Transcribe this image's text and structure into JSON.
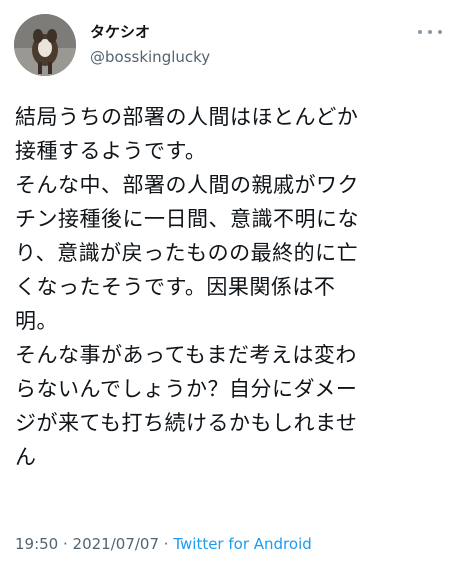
{
  "author": {
    "display_name": "タケシオ",
    "handle": "@bosskinglucky",
    "avatar_icon": "dog-photo-avatar"
  },
  "more_icon": "more-horizontal-icon",
  "tweet": {
    "lines": [
      "結局うちの部署の人間はほとんどか",
      "接種するようです。",
      "そんな中、部署の人間の親戚がワク",
      "チン接種後に一日間、意識不明にな",
      "り、意識が戻ったものの最終的に亡",
      "くなったそうです。因果関係は不",
      "明。",
      "そんな事があってもまだ考えは変わ",
      "らないんでしょうか？自分にダメー",
      "ジが来ても打ち続けるかもしれませ",
      "ん"
    ]
  },
  "meta": {
    "time": "19:50",
    "separator1": " · ",
    "date": "2021/07/07",
    "separator2": " · ",
    "source": "Twitter for Android"
  },
  "colors": {
    "text": "#0f1419",
    "secondary": "#536471",
    "link": "#1d9bf0"
  }
}
